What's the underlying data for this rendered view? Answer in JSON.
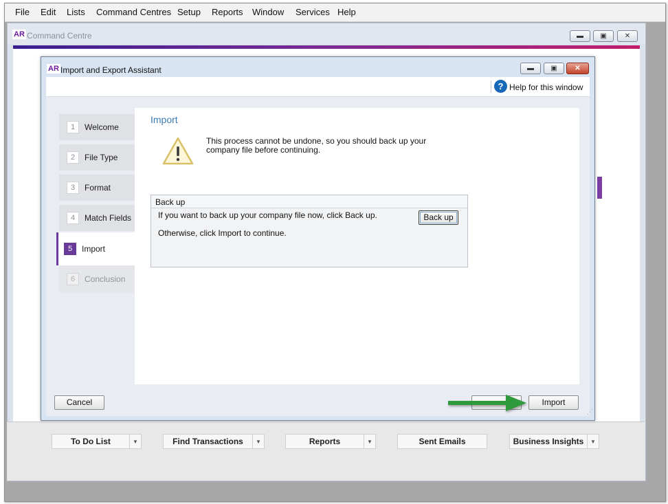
{
  "menubar": {
    "items": [
      "File",
      "Edit",
      "Lists",
      "Command Centres",
      "Setup",
      "Reports",
      "Window",
      "Services",
      "Help"
    ]
  },
  "command_centre": {
    "logo": "AR",
    "title": "Command Centre",
    "footer_buttons": [
      {
        "label": "To Do List",
        "has_dropdown": true
      },
      {
        "label": "Find Transactions",
        "has_dropdown": true
      },
      {
        "label": "Reports",
        "has_dropdown": true
      },
      {
        "label": "Sent Emails",
        "has_dropdown": false
      },
      {
        "label": "Business Insights",
        "has_dropdown": true
      }
    ]
  },
  "dialog": {
    "logo": "AR",
    "title": "Import and Export Assistant",
    "help_label": "Help for this window",
    "steps": [
      {
        "num": "1",
        "label": "Welcome",
        "state": "done"
      },
      {
        "num": "2",
        "label": "File Type",
        "state": "done"
      },
      {
        "num": "3",
        "label": "Format",
        "state": "done"
      },
      {
        "num": "4",
        "label": "Match Fields",
        "state": "done"
      },
      {
        "num": "5",
        "label": "Import",
        "state": "active"
      },
      {
        "num": "6",
        "label": "Conclusion",
        "state": "disabled"
      }
    ],
    "content": {
      "heading": "Import",
      "warning_text": "This process cannot be undone, so you should back up your company file before continuing.",
      "backup_section": {
        "title": "Back up",
        "line1": "If you want to back up your company file now, click Back up.",
        "line2": "Otherwise, click Import to continue.",
        "button_label": "Back up"
      }
    },
    "buttons": {
      "cancel": "Cancel",
      "import": "Import"
    }
  },
  "colors": {
    "accent_purple": "#6a3a9a",
    "heading_blue": "#3d79b5",
    "help_blue": "#1769b8",
    "arrow_green": "#2f9a3a"
  }
}
